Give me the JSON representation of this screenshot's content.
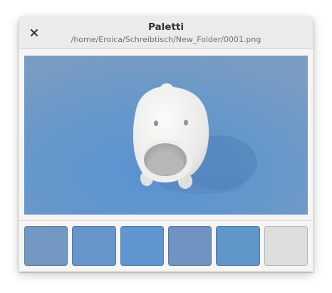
{
  "window": {
    "title": "Paletti",
    "subtitle": "/home/Eroica/Schreibtisch/New_Folder/0001.png"
  },
  "icons": {
    "close": "close-icon"
  },
  "palette": {
    "swatches": [
      {
        "color": "#7297c0"
      },
      {
        "color": "#6696c9"
      },
      {
        "color": "#5f95d0"
      },
      {
        "color": "#7093c1"
      },
      {
        "color": "#6196cb"
      },
      {
        "color": "#dddedc"
      }
    ]
  }
}
